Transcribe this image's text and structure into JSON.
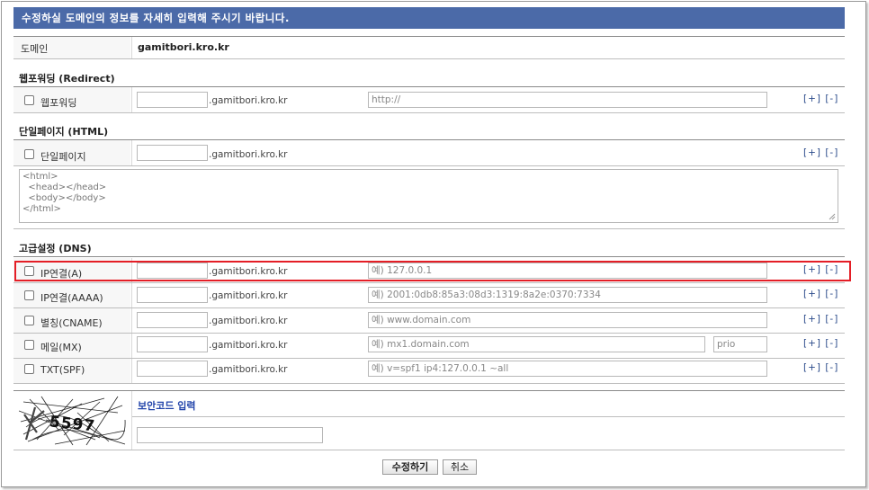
{
  "header": {
    "title": "수정하실 도메인의 정보를 자세히 입력해 주시기 바랍니다."
  },
  "domain_row": {
    "label": "도메인",
    "value": "gamitbori.kro.kr"
  },
  "redirect": {
    "section_title": "웹포워딩 (Redirect)",
    "checkbox_label": "웹포워딩",
    "domain_suffix": ".gamitbori.kro.kr",
    "url_placeholder": "http://",
    "plus_minus": "[+] [-]"
  },
  "html_page": {
    "section_title": "단일페이지 (HTML)",
    "checkbox_label": "단일페이지",
    "domain_suffix": ".gamitbori.kro.kr",
    "plus_minus": "[+] [-]",
    "textarea_value": "<html>\n  <head></head>\n  <body></body>\n</html>"
  },
  "dns": {
    "section_title": "고급설정 (DNS)",
    "rows": [
      {
        "label": "IP연결(A)",
        "domain_suffix": ".gamitbori.kro.kr",
        "placeholder": "예) 127.0.0.1",
        "plus_minus": "[+] [-]"
      },
      {
        "label": "IP연결(AAAA)",
        "domain_suffix": ".gamitbori.kro.kr",
        "placeholder": "예) 2001:0db8:85a3:08d3:1319:8a2e:0370:7334",
        "plus_minus": "[+] [-]"
      },
      {
        "label": "별칭(CNAME)",
        "domain_suffix": ".gamitbori.kro.kr",
        "placeholder": "예) www.domain.com",
        "plus_minus": "[+] [-]"
      },
      {
        "label": "메일(MX)",
        "domain_suffix": ".gamitbori.kro.kr",
        "placeholder": "예) mx1.domain.com",
        "prio_placeholder": "prio",
        "plus_minus": "[+] [-]"
      },
      {
        "label": "TXT(SPF)",
        "domain_suffix": ".gamitbori.kro.kr",
        "placeholder": "예) v=spf1 ip4:127.0.0.1 ~all",
        "plus_minus": "[+] [-]"
      }
    ]
  },
  "security": {
    "title": "보안코드 입력",
    "captcha_code": "5597"
  },
  "buttons": {
    "submit": "수정하기",
    "cancel": "취소"
  },
  "colors": {
    "header_bg": "#4b6aa8",
    "highlight_border": "#e41e26",
    "link": "#2a4a8a"
  }
}
